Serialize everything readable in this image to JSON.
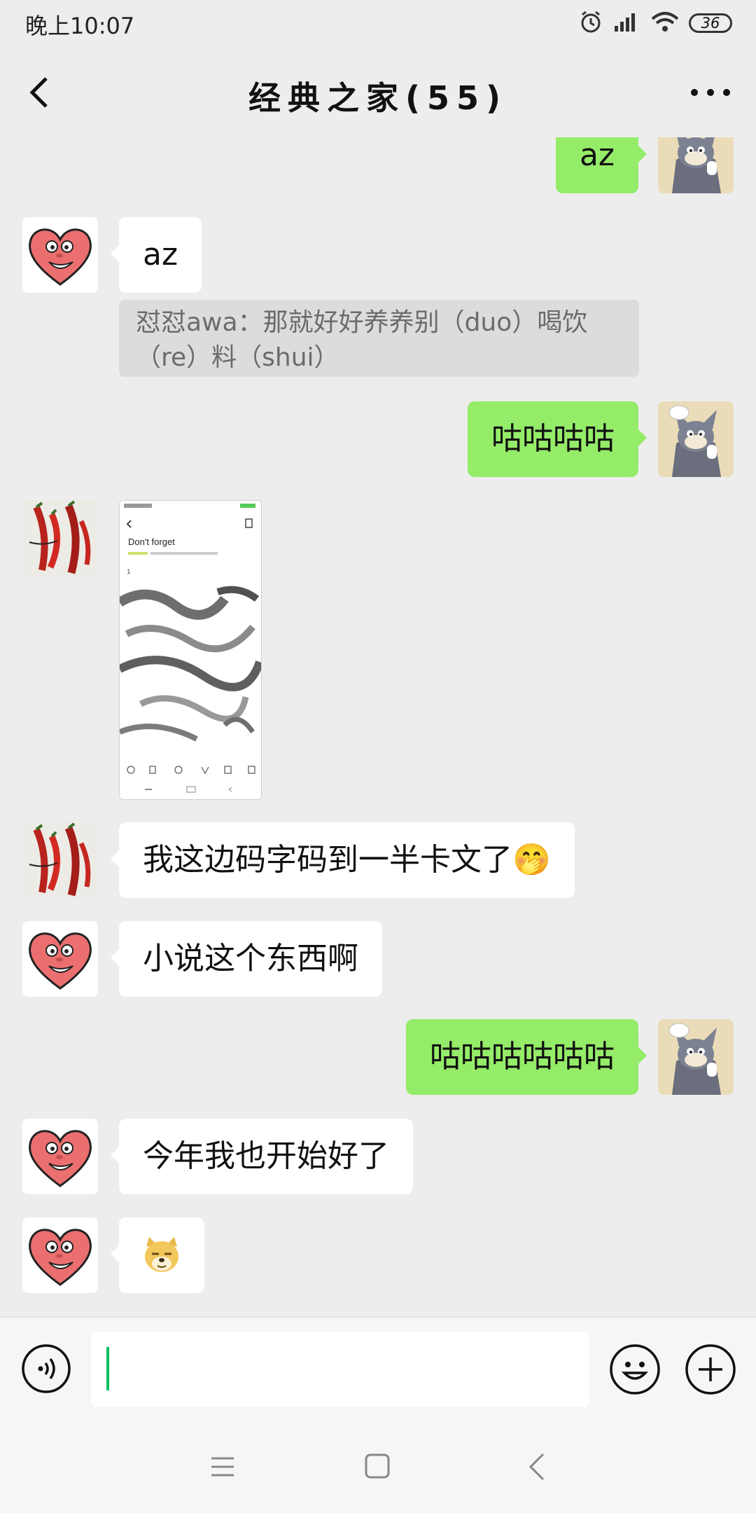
{
  "status_bar": {
    "time": "晚上10:07",
    "battery": "36",
    "icons": [
      "alarm-icon",
      "signal-icon",
      "wifi-icon",
      "battery-icon"
    ]
  },
  "header": {
    "title": "经典之家(55)",
    "back_icon": "chevron-left-icon",
    "more_icon": "more-dots-icon"
  },
  "messages": [
    {
      "side": "right",
      "type": "text",
      "text": "az",
      "avatar": "tom-cat-avatar"
    },
    {
      "side": "left",
      "type": "text",
      "text": "az",
      "avatar": "heart-face-avatar",
      "quote": "怼怼awa：那就好好养养别（duo）喝饮（re）料（shui）"
    },
    {
      "side": "right",
      "type": "text",
      "text": "咕咕咕咕",
      "avatar": "tom-cat-avatar"
    },
    {
      "side": "left",
      "type": "image",
      "avatar": "chili-pepper-avatar",
      "image": {
        "title": "Don't forget",
        "corner_text": "1"
      }
    },
    {
      "side": "left",
      "type": "text",
      "text": "我这边码字码到一半卡文了🤭",
      "avatar": "chili-pepper-avatar"
    },
    {
      "side": "left",
      "type": "text",
      "text": "小说这个东西啊",
      "avatar": "heart-face-avatar"
    },
    {
      "side": "right",
      "type": "text",
      "text": "咕咕咕咕咕咕",
      "avatar": "tom-cat-avatar"
    },
    {
      "side": "left",
      "type": "text",
      "text": "今年我也开始好了",
      "avatar": "heart-face-avatar"
    },
    {
      "side": "left",
      "type": "emoji",
      "avatar": "heart-face-avatar",
      "emoji": "doge-face-icon"
    }
  ],
  "input_bar": {
    "value": "",
    "voice_icon": "voice-icon",
    "emoji_icon": "emoji-smile-icon",
    "plus_icon": "plus-circle-icon"
  },
  "nav_bar": {
    "icons": [
      "menu-icon",
      "home-square-icon",
      "back-chevron-icon"
    ]
  },
  "colors": {
    "background": "#ededed",
    "sent_bubble": "#95ec69",
    "received_bubble": "#ffffff",
    "quote_background": "#dcdcdc",
    "cursor": "#07c160"
  }
}
